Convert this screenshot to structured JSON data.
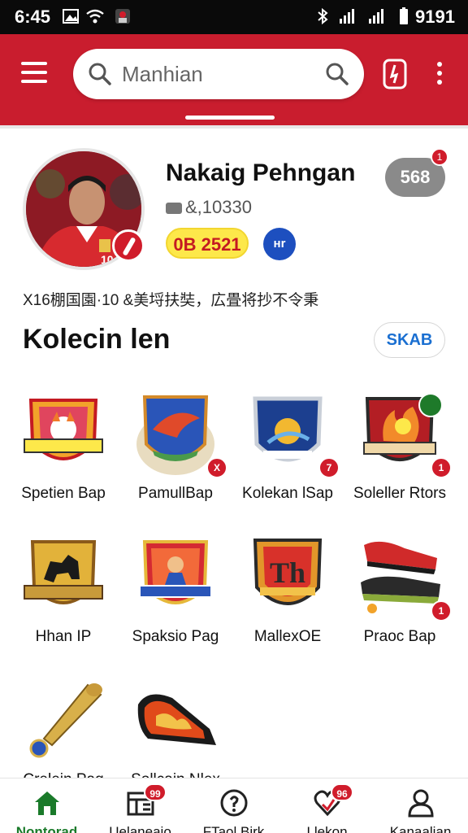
{
  "status_bar": {
    "time": "6:45",
    "right_text": "9191"
  },
  "header": {
    "search_value": "Manhian",
    "colors": {
      "brand": "#c91d2e"
    }
  },
  "profile": {
    "name": "Nakaig Pehngan",
    "stat": "&,10330",
    "pill_yellow": "0B 2521",
    "pill_blue": "ʜr",
    "count": "568",
    "count_dot": "1",
    "description": "X16棚国園·10 &美埒扶奘，広畳将抄不令秉"
  },
  "section": {
    "title": "Kolecin len",
    "button": "SKAB"
  },
  "grid": [
    {
      "label": "Spetien Bap",
      "icon": "fox-crest-icon",
      "badge": ""
    },
    {
      "label": "PamullBap",
      "icon": "eagle-crest-icon",
      "badge": "X"
    },
    {
      "label": "Kolekan lSap",
      "icon": "ball-crest-icon",
      "badge": "7"
    },
    {
      "label": "Soleller Rtors",
      "icon": "flame-crest-icon",
      "badge": "1"
    },
    {
      "label": "Hhan IP",
      "icon": "dog-crest-icon",
      "badge": ""
    },
    {
      "label": "Spaksio Pag",
      "icon": "player-crest-icon",
      "badge": ""
    },
    {
      "label": "MallexOE",
      "icon": "letter-crest-icon",
      "badge": ""
    },
    {
      "label": "Praoc Bap",
      "icon": "boots-icon",
      "badge": "1"
    },
    {
      "label": "Crelein Pag",
      "icon": "trumpet-icon",
      "badge": ""
    },
    {
      "label": "Sollcain Nlex",
      "icon": "flame-boot-icon",
      "badge": ""
    }
  ],
  "bottom_nav": [
    {
      "label": "Nontorad",
      "icon": "home-icon",
      "badge": "",
      "active": true
    },
    {
      "label": "Uelaneaio",
      "icon": "grid-list-icon",
      "badge": "99",
      "active": false
    },
    {
      "label": "FTaol Birk",
      "icon": "info-circle-icon",
      "badge": "",
      "active": false
    },
    {
      "label": "Llekon",
      "icon": "heart-icon",
      "badge": "96",
      "active": false
    },
    {
      "label": "Kanaalian",
      "icon": "person-icon",
      "badge": "",
      "active": false
    }
  ]
}
